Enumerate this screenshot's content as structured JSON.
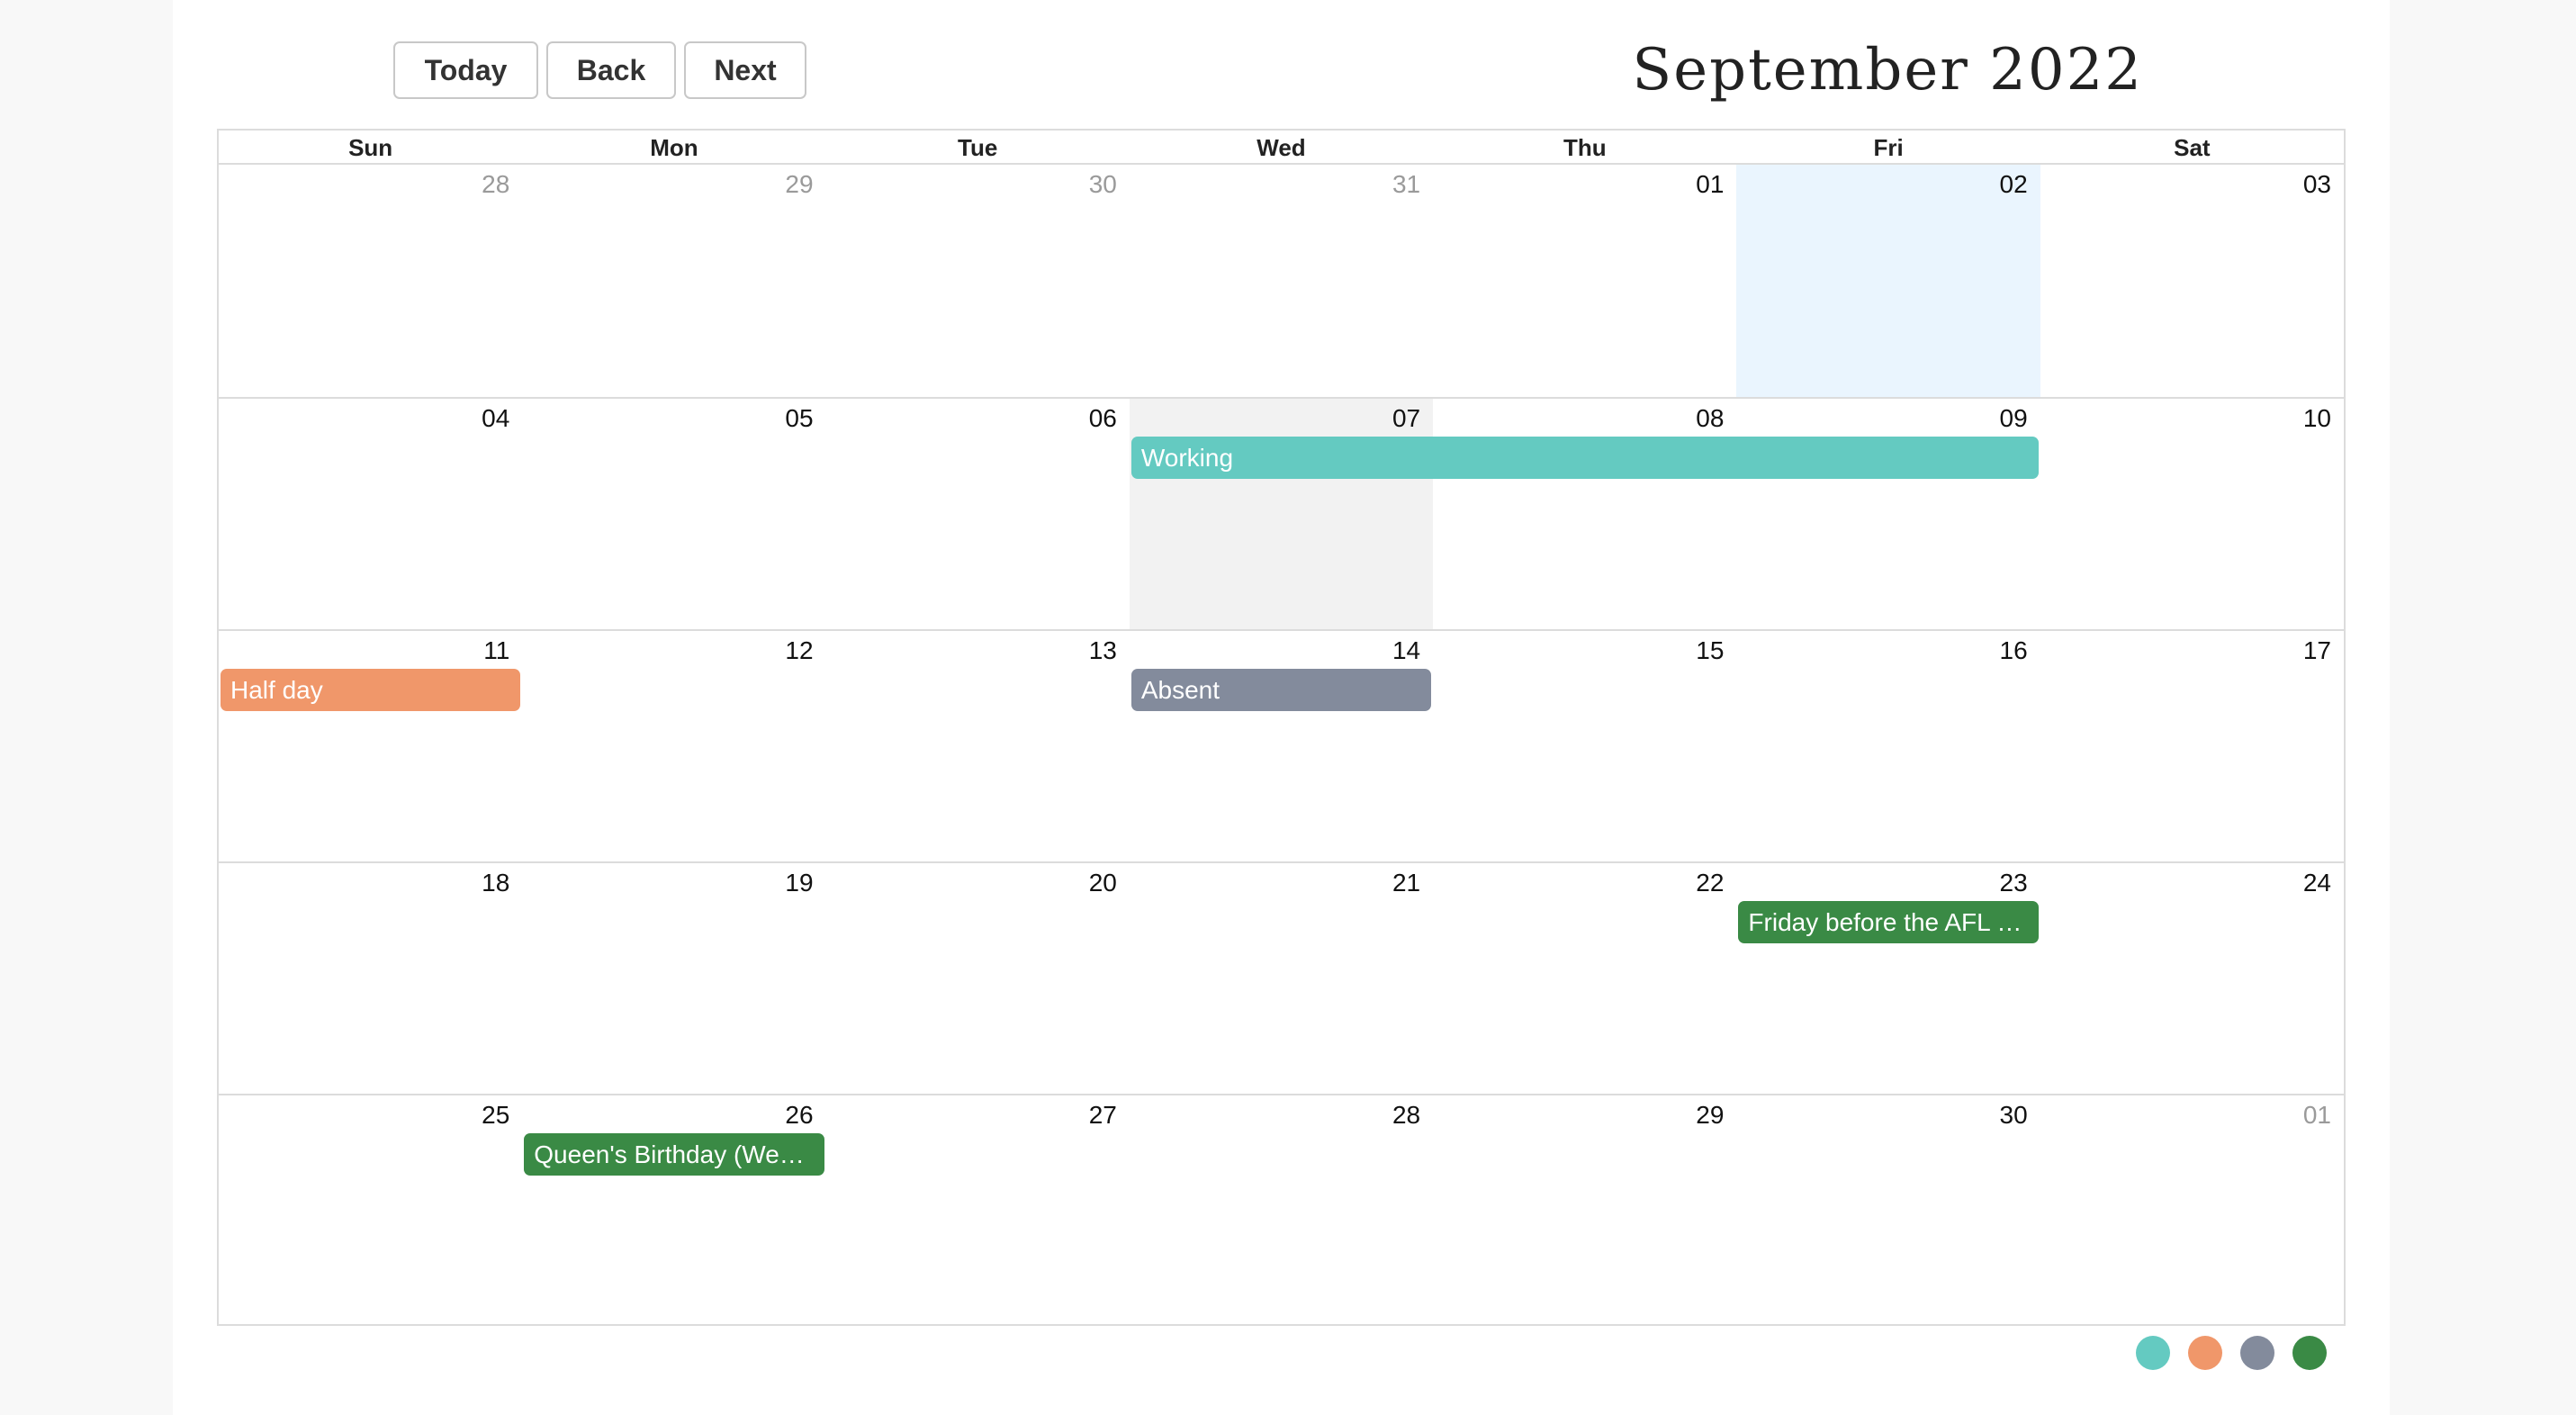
{
  "toolbar": {
    "today": "Today",
    "back": "Back",
    "next": "Next"
  },
  "title": "September 2022",
  "weekdays": [
    "Sun",
    "Mon",
    "Tue",
    "Wed",
    "Thu",
    "Fri",
    "Sat"
  ],
  "weeks": [
    [
      "28",
      "29",
      "30",
      "31",
      "01",
      "02",
      "03"
    ],
    [
      "04",
      "05",
      "06",
      "07",
      "08",
      "09",
      "10"
    ],
    [
      "11",
      "12",
      "13",
      "14",
      "15",
      "16",
      "17"
    ],
    [
      "18",
      "19",
      "20",
      "21",
      "22",
      "23",
      "24"
    ],
    [
      "25",
      "26",
      "27",
      "28",
      "29",
      "30",
      "01"
    ]
  ],
  "outside_month": [
    [
      0,
      0
    ],
    [
      0,
      1
    ],
    [
      0,
      2
    ],
    [
      0,
      3
    ],
    [
      4,
      6
    ]
  ],
  "today_cell": [
    0,
    5
  ],
  "selected_cell": [
    1,
    3
  ],
  "events": [
    {
      "label": "Working",
      "week": 1,
      "start": 3,
      "end": 5,
      "color": "#64cac1"
    },
    {
      "label": "Half day",
      "week": 2,
      "start": 0,
      "end": 0,
      "color": "#f0976a"
    },
    {
      "label": "Absent",
      "week": 2,
      "start": 3,
      "end": 3,
      "color": "#838b9c"
    },
    {
      "label": "Friday before the AFL Grand Final (Victoria)",
      "week": 3,
      "start": 5,
      "end": 5,
      "color": "#3a8a45"
    },
    {
      "label": "Queen's Birthday (Western Australia)",
      "week": 4,
      "start": 1,
      "end": 1,
      "color": "#3a8a45"
    }
  ],
  "legend": [
    {
      "color": "#64cac1",
      "icon": "working-dot"
    },
    {
      "color": "#f0976a",
      "icon": "half-day-dot"
    },
    {
      "color": "#838b9c",
      "icon": "absent-dot"
    },
    {
      "color": "#3a8a45",
      "icon": "holiday-dot"
    }
  ]
}
